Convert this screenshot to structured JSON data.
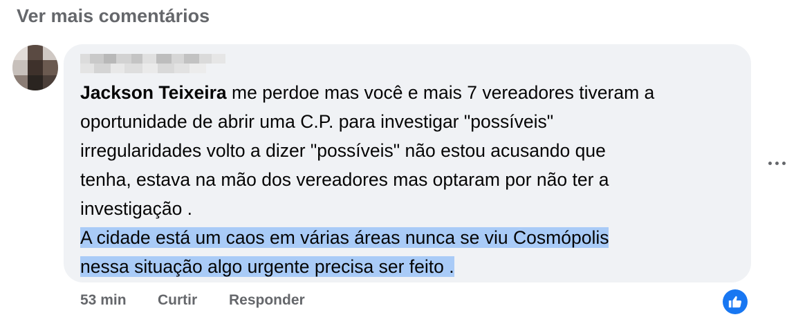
{
  "header": {
    "more_comments_label": "Ver mais comentários"
  },
  "comment": {
    "mention": "Jackson Teixeira",
    "lines": [
      " me perdoe mas você e mais 7 vereadores tiveram a",
      "oportunidade de abrir uma C.P. para investigar \"possíveis\"",
      "irregularidades volto a dizer \"possíveis\" não estou acusando que",
      "tenha, estava na mão dos vereadores mas optaram por não ter a",
      "investigação ."
    ],
    "highlighted_lines": [
      "A cidade está um caos em várias áreas nunca se viu Cosmópolis",
      "nessa situação algo urgente precisa ser feito ."
    ],
    "highlight_color": "#a9cbf7",
    "bubble_color": "#f0f2f5"
  },
  "actions": {
    "time": "53 min",
    "like_label": "Curtir",
    "reply_label": "Responder"
  },
  "icons": {
    "more_options": "ellipsis-icon",
    "like_reaction": "thumbs-up-icon",
    "like_color": "#1877f2"
  }
}
